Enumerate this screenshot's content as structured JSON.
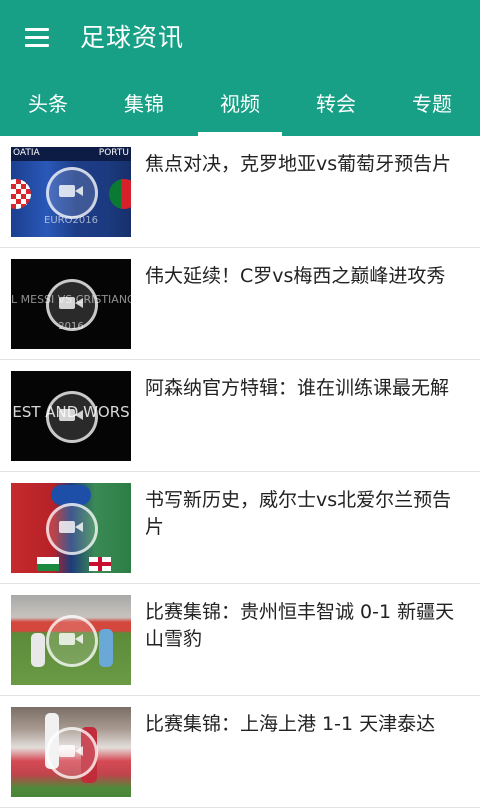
{
  "app": {
    "title": "足球资讯",
    "theme_color": "#17a085"
  },
  "tabs": [
    {
      "label": "头条",
      "active": false
    },
    {
      "label": "集锦",
      "active": false
    },
    {
      "label": "视频",
      "active": true
    },
    {
      "label": "转会",
      "active": false
    },
    {
      "label": "专题",
      "active": false
    }
  ],
  "videos": [
    {
      "title": "焦点对决，克罗地亚vs葡萄牙预告片",
      "thumb_text_left": "OATIA",
      "thumb_text_right": "PORTU",
      "thumb_caption": "EURO2016"
    },
    {
      "title": "伟大延续！C罗vs梅西之巅峰进攻秀",
      "thumb_text": "L MESSI VS CRISTIANO RON",
      "thumb_caption": "2016"
    },
    {
      "title": "阿森纳官方特辑：谁在训练课最无解",
      "thumb_text": "EST AND WORS"
    },
    {
      "title": "书写新历史，威尔士vs北爱尔兰预告片"
    },
    {
      "title": "比赛集锦：贵州恒丰智诚 0-1 新疆天山雪豹"
    },
    {
      "title": "比赛集锦：上海上港 1-1 天津泰达"
    }
  ]
}
